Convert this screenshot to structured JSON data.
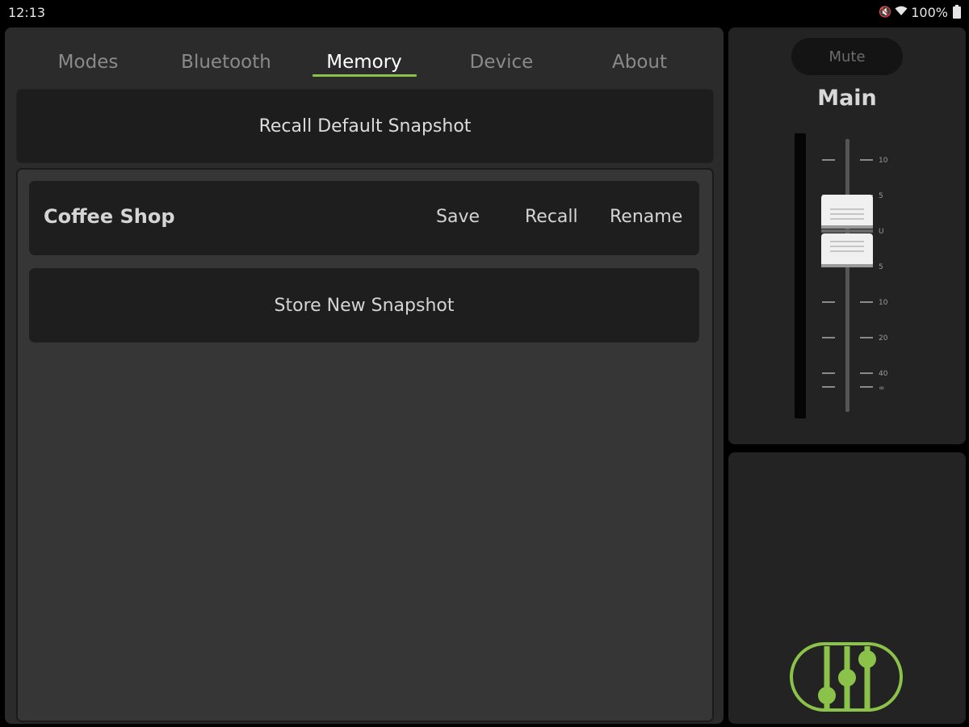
{
  "status_bar": {
    "time": "12:13",
    "battery": "100%",
    "icons": [
      "mute-icon",
      "wifi-icon",
      "battery-icon"
    ]
  },
  "tabs": [
    {
      "label": "Modes",
      "active": false
    },
    {
      "label": "Bluetooth",
      "active": false
    },
    {
      "label": "Memory",
      "active": true
    },
    {
      "label": "Device",
      "active": false
    },
    {
      "label": "About",
      "active": false
    }
  ],
  "memory": {
    "recall_default_label": "Recall Default Snapshot",
    "snapshots": [
      {
        "name": "Coffee Shop",
        "save_label": "Save",
        "recall_label": "Recall",
        "rename_label": "Rename"
      }
    ],
    "store_new_label": "Store New Snapshot"
  },
  "fader": {
    "mute_label": "Mute",
    "channel_name": "Main",
    "scale_labels": [
      "10",
      "5",
      "U",
      "5",
      "10",
      "20",
      "40",
      "∞"
    ]
  },
  "colors": {
    "accent": "#8bc34a",
    "panel": "#2b2b2b",
    "button": "#1e1e1e"
  },
  "logo": {
    "icon": "mixer-logo-icon"
  }
}
